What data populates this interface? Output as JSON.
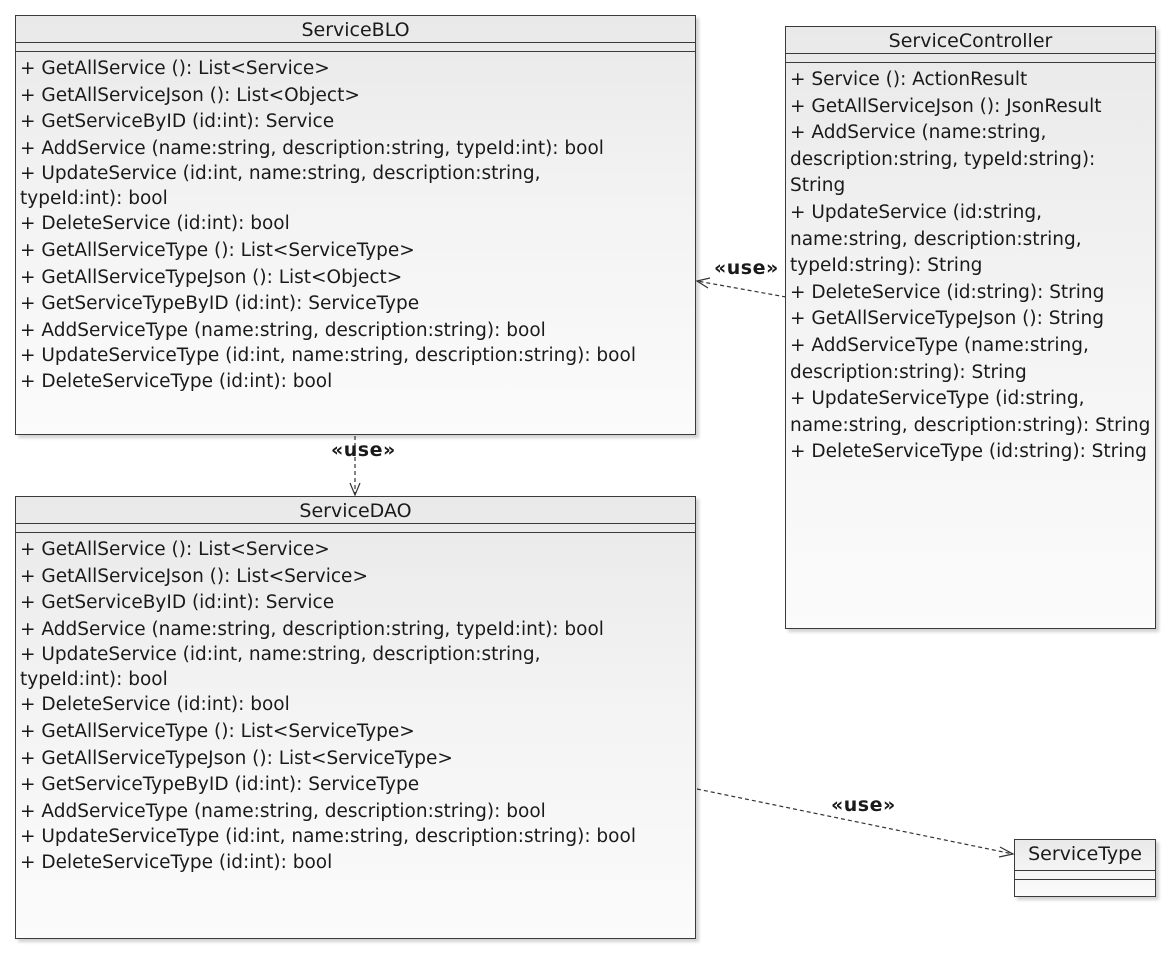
{
  "classes": {
    "serviceblo": {
      "name": "ServiceBLO",
      "operations": [
        "+ GetAllService (): List<Service>",
        "+ GetAllServiceJson (): List<Object>",
        "+ GetServiceByID (id:int): Service",
        "+ AddService (name:string, description:string, typeId:int): bool",
        "+ UpdateService (id:int, name:string, description:string, typeId:int): bool",
        "+ DeleteService (id:int): bool",
        "+ GetAllServiceType (): List<ServiceType>",
        "+ GetAllServiceTypeJson (): List<Object>",
        "+ GetServiceTypeByID (id:int): ServiceType",
        "+ AddServiceType (name:string, description:string): bool",
        "+ UpdateServiceType (id:int, name:string, description:string): bool",
        "+ DeleteServiceType (id:int): bool"
      ]
    },
    "servicecontroller": {
      "name": "ServiceController",
      "operations": [
        "+ Service (): ActionResult",
        "+ GetAllServiceJson (): JsonResult",
        "+ AddService (name:string, description:string, typeId:string): String",
        "+ UpdateService (id:string, name:string, description:string, typeId:string): String",
        "+ DeleteService (id:string): String",
        "+ GetAllServiceTypeJson (): String",
        "+ AddServiceType (name:string, description:string): String",
        "+ UpdateServiceType (id:string, name:string, description:string): String",
        "+ DeleteServiceType (id:string): String"
      ]
    },
    "servicedao": {
      "name": "ServiceDAO",
      "operations": [
        "+ GetAllService (): List<Service>",
        "+ GetAllServiceJson (): List<Service>",
        "+ GetServiceByID (id:int): Service",
        "+ AddService (name:string, description:string, typeId:int): bool",
        "+ UpdateService (id:int, name:string, description:string, typeId:int): bool",
        "+ DeleteService (id:int): bool",
        "+ GetAllServiceType (): List<ServiceType>",
        "+ GetAllServiceTypeJson (): List<ServiceType>",
        "+ GetServiceTypeByID (id:int): ServiceType",
        "+ AddServiceType (name:string, description:string): bool",
        "+ UpdateServiceType (id:int, name:string, description:string): bool",
        "+ DeleteServiceType (id:int): bool"
      ]
    },
    "servicetype": {
      "name": "ServiceType"
    }
  },
  "relations": {
    "controller_to_blo": "«use»",
    "blo_to_dao": "«use»",
    "dao_to_servicetype": "«use»"
  }
}
